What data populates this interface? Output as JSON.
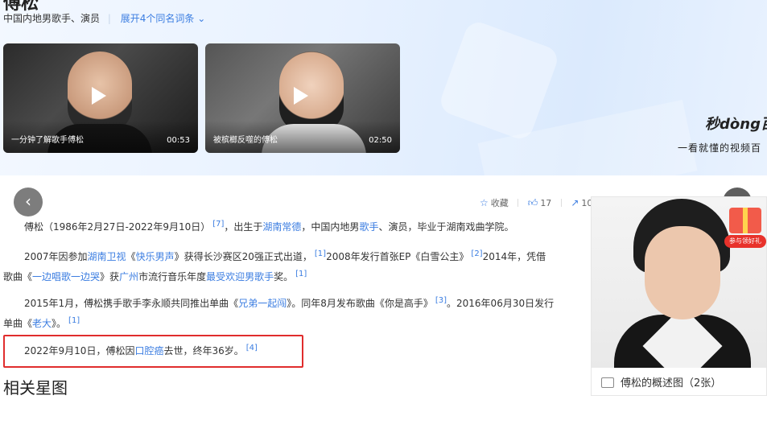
{
  "header": {
    "title_cut": "傅松",
    "subtitle": "中国内地男歌手、演员",
    "expand_link": "展开4个同名词条",
    "expand_icon": "chevron-down-icon"
  },
  "videos": [
    {
      "caption": "一分钟了解歌手傅松",
      "duration": "00:53"
    },
    {
      "caption": "被槟榔反噬的傅松",
      "duration": "02:50"
    }
  ],
  "brand": {
    "name": "秒dòng百",
    "slogan": "一看就懂的视频百"
  },
  "actions": {
    "favorite_label": "收藏",
    "like_count": "17",
    "share_count": "10"
  },
  "paragraphs": {
    "p1": {
      "pre": "傅松（1986年2月27日-2022年9月10日）",
      "ref1": "[7]",
      "mid": "，出生于",
      "link1": "湖南常德",
      "mid2": "，中国内地男",
      "link2": "歌手",
      "post": "、演员，毕业于湖南戏曲学院。"
    },
    "p2": {
      "pre": "2007年因参加",
      "link1": "湖南卫视",
      "quote_open": "《",
      "link2": "快乐男声",
      "quote_close": "》",
      "mid": "获得长沙赛区20强正式出道，",
      "ref1": "[1]",
      "mid2": "2008年发行首张EP《白雪公主》",
      "ref2": "[2]",
      "mid3": "2014年，凭借",
      "line2_pre": "歌曲《",
      "link3": "一边唱歌一边哭",
      "line2_mid": "》获",
      "link4": "广州",
      "line2_mid2": "市流行音乐年度",
      "link5": "最受欢迎男歌手",
      "line2_post": "奖。",
      "ref3": "[1]"
    },
    "p3": {
      "pre": "2015年1月，傅松携手歌手李永顺共同推出单曲《",
      "link1": "兄弟一起闯",
      "mid": "》。同年8月发布歌曲《你是高手》",
      "ref1": "[3]",
      "mid2": "。2016年06月30日发行",
      "line2_pre": "单曲《",
      "link2": "老大",
      "line2_post": "》。",
      "ref2": "[1]"
    },
    "p4": {
      "pre": "2022年9月10日，傅松因",
      "link1": "口腔癌",
      "post": "去世，终年36岁。",
      "ref1": "[4]"
    }
  },
  "related": {
    "title": "相关星图"
  },
  "side_card": {
    "caption": "傅松的概述图（2张）",
    "gift_label": "参与领好礼"
  },
  "colors": {
    "link": "#3b7de1",
    "highlight_border": "#e02d2d"
  }
}
